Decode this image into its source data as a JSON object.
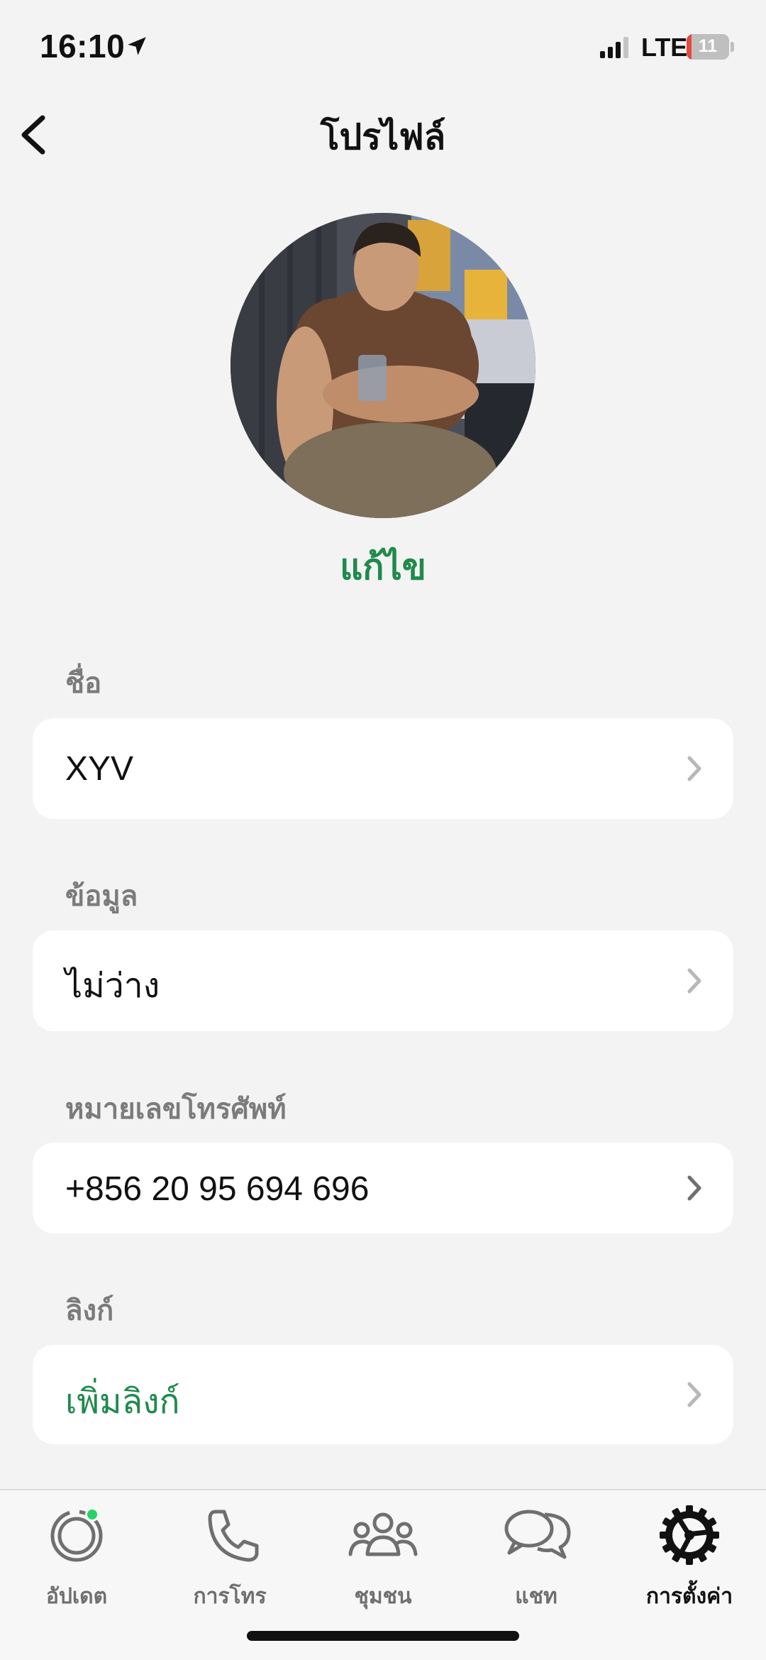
{
  "status_bar": {
    "time": "16:10",
    "network": "LTE",
    "battery_level": "11",
    "battery_fraction": 0.11,
    "battery_color": "#e34b3f"
  },
  "header": {
    "title": "โปรไฟล์",
    "back_icon": "chevron-left-icon"
  },
  "profile": {
    "edit_label": "แก้ไข",
    "accent_color": "#1f8a4c"
  },
  "fields": {
    "name": {
      "label": "ชื่อ",
      "value": "XYV"
    },
    "about": {
      "label": "ข้อมูล",
      "value": "ไม่ว่าง"
    },
    "phone": {
      "label": "หมายเลขโทรศัพท์",
      "value": "+856 20 95 694 696"
    },
    "links": {
      "label": "ลิงก์",
      "value": "เพิ่มลิงก์"
    }
  },
  "tabs": [
    {
      "label": "อัปเดต",
      "icon": "updates-icon",
      "badge": true
    },
    {
      "label": "การโทร",
      "icon": "phone-icon"
    },
    {
      "label": "ชุมชน",
      "icon": "communities-icon"
    },
    {
      "label": "แชท",
      "icon": "chats-icon"
    },
    {
      "label": "การตั้งค่า",
      "icon": "settings-icon",
      "active": true
    }
  ]
}
